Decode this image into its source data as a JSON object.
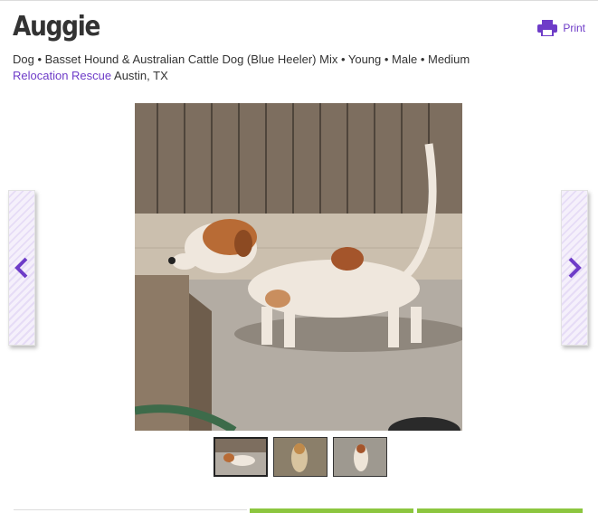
{
  "pet": {
    "name": "Auggie",
    "attributes": "Dog • Basset Hound & Australian Cattle Dog (Blue Heeler) Mix • Young • Male • Medium",
    "organization": "Relocation Rescue",
    "location": "Austin, TX"
  },
  "actions": {
    "print_label": "Print",
    "print_icon": "printer-icon",
    "prev_icon": "chevron-left-icon",
    "next_icon": "chevron-right-icon"
  },
  "gallery": {
    "photo_count": 3,
    "active_index": 0
  },
  "colors": {
    "accent": "#6e3cc8",
    "text": "#333333",
    "action_bar": "#8cc63f"
  }
}
